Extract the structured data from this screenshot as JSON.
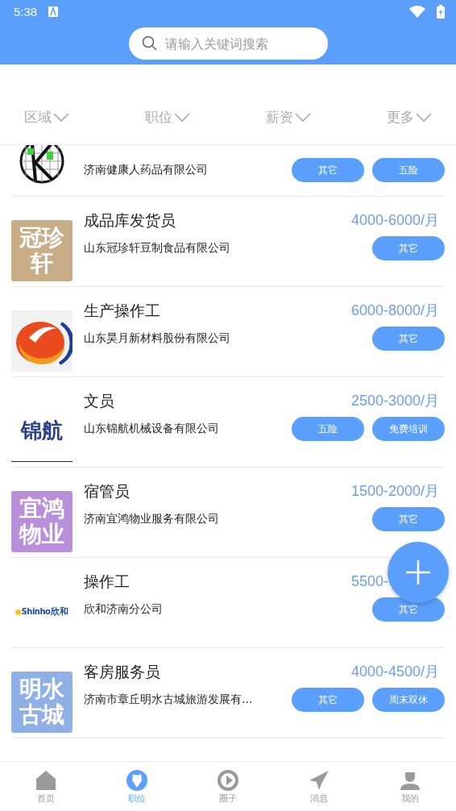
{
  "status_bar": {
    "time": "5:38"
  },
  "search": {
    "placeholder": "请输入关键词搜索"
  },
  "filters": [
    "区域",
    "职位",
    "薪资",
    "更多"
  ],
  "jobs": [
    {
      "kind": "partial",
      "company": "济南健康人药品有限公司",
      "logo": {
        "kind": "globe"
      },
      "tags": [
        "其它",
        "五险"
      ]
    },
    {
      "kind": "full",
      "title": "成品库发货员",
      "salary": "4000-6000/月",
      "company": "山东冠珍轩豆制食品有限公司",
      "logo": {
        "kind": "text",
        "lines": [
          "冠珍",
          "轩"
        ],
        "color": "#c8ad87"
      },
      "tags": [
        "其它"
      ]
    },
    {
      "kind": "full",
      "title": "生产操作工",
      "salary": "6000-8000/月",
      "company": "山东昊月新材料股份有限公司",
      "logo": {
        "kind": "swoosh"
      },
      "tags": [
        "其它"
      ]
    },
    {
      "kind": "full",
      "title": "文员",
      "salary": "2500-3000/月",
      "company": "山东锦航机械设备有限公司",
      "logo": {
        "kind": "wordmark",
        "lines": [
          "锦航"
        ],
        "color": "#ffffff"
      },
      "tags": [
        "五险",
        "免费培训"
      ]
    },
    {
      "kind": "full",
      "title": "宿管员",
      "salary": "1500-2000/月",
      "company": "济南宜鸿物业服务有限公司",
      "logo": {
        "kind": "text",
        "lines": [
          "宜鸿",
          "物业"
        ],
        "color": "#b98fd9"
      },
      "tags": [
        "其它"
      ]
    },
    {
      "kind": "full",
      "title": "操作工",
      "salary": "5500-",
      "company": "欣和济南分公司",
      "logo": {
        "kind": "shinho",
        "lines": [
          "Shinho",
          "欣和"
        ]
      },
      "tags": [
        "其它"
      ]
    },
    {
      "kind": "full",
      "title": "客房服务员",
      "salary": "4000-4500/月",
      "company": "济南市章丘明水古城旅游发展有…",
      "logo": {
        "kind": "text",
        "lines": [
          "明水",
          "古城"
        ],
        "color": "#8fb0e6"
      },
      "tags": [
        "其它",
        "周末双休"
      ]
    }
  ],
  "nav": [
    {
      "label": "首页",
      "kind": "home",
      "selected": false
    },
    {
      "label": "职位",
      "kind": "badge",
      "selected": true
    },
    {
      "label": "圈子",
      "kind": "circle",
      "selected": false
    },
    {
      "label": "消息",
      "kind": "plane",
      "selected": false
    },
    {
      "label": "我的",
      "kind": "person",
      "selected": false
    }
  ]
}
